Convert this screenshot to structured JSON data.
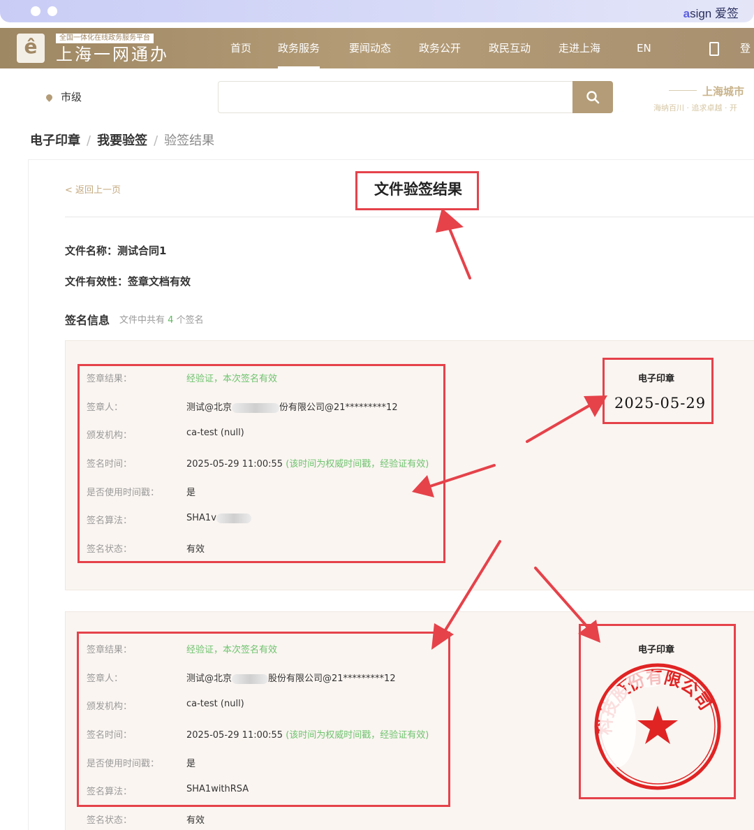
{
  "frame": {
    "brand_a": "a",
    "brand_rest": "sign 爱签"
  },
  "header": {
    "logo_tag": "全国一体化在线政务服务平台",
    "logo_title": "上海一网通办",
    "nav": [
      "首页",
      "政务服务",
      "要闻动态",
      "政务公开",
      "政民互动",
      "走进上海",
      "EN"
    ],
    "active_nav": "政务服务",
    "login": "登"
  },
  "search_bar": {
    "location": "市级",
    "placeholder": "",
    "city_brand": "上海城市",
    "city_sub": "海纳百川 · 追求卓越 · 开"
  },
  "breadcrumb": {
    "items": [
      "电子印章",
      "我要验签"
    ],
    "current": "验签结果",
    "separator": "/"
  },
  "result": {
    "back": "< 返回上一页",
    "title": "文件验签结果",
    "file_name": "文件名称：测试合同1",
    "file_validity": "文件有效性：签章文档有效",
    "sig_heading": "签名信息",
    "sig_count_prefix": "文件中共有",
    "sig_count": "4",
    "sig_count_suffix": "个签名"
  },
  "labels": {
    "result": "签章结果：",
    "signer": "签章人：",
    "issuer": "颁发机构：",
    "time": "签名时间：",
    "timestamp": "是否使用时间戳：",
    "algorithm": "签名算法：",
    "status": "签名状态："
  },
  "signatures": [
    {
      "result": "经验证，本次签名有效",
      "signer_prefix": "测试@北京",
      "signer_suffix": "份有限公司@21*********12",
      "issuer": "ca-test (null)",
      "time": "2025-05-29 11:00:55",
      "time_note": "(该时间为权威时间戳，经验证有效)",
      "timestamp": "是",
      "algorithm": "SHA1v",
      "status": "有效"
    },
    {
      "result": "经验证，本次签名有效",
      "signer_prefix": "测试@北京",
      "signer_suffix": "股份有限公司@21*********12",
      "issuer": "ca-test (null)",
      "time": "2025-05-29 11:00:55",
      "time_note": "(该时间为权威时间戳，经验证有效)",
      "timestamp": "是",
      "algorithm": "SHA1withRSA",
      "status": "有效"
    }
  ],
  "seals": {
    "date_seal_label": "电子印章",
    "date_seal_value": "2025-05-29",
    "stamp_seal_label": "电子印章",
    "stamp_text": "科技股份有限公司"
  },
  "colors": {
    "accent": "#b39c77",
    "highlight": "#e5424a",
    "valid": "#6ec36e",
    "stamp": "#e02424"
  }
}
